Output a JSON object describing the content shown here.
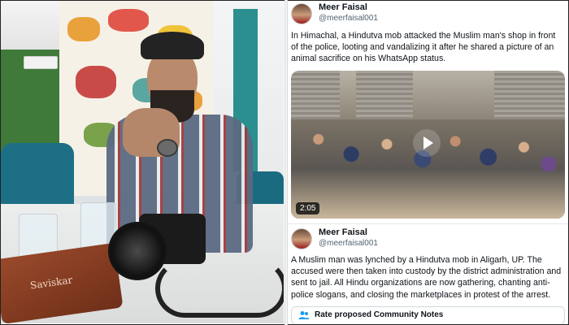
{
  "tweets": [
    {
      "name": "Meer Faisal",
      "handle": "@meerfaisal001",
      "text": "In Himachal, a Hindutva mob attacked the Muslim man's shop in front of the police, looting and vandalizing it after he shared a picture of an animal sacrifice on his WhatsApp status.",
      "video": {
        "duration": "2:05",
        "icon": "play-icon"
      }
    },
    {
      "name": "Meer Faisal",
      "handle": "@meerfaisal001",
      "text": "A Muslim man was lynched by a Hindutva mob in Aligarh, UP. The accused were then taken into custody by the district administration and sent to jail. All Hindu organizations are now gathering, chanting anti-police slogans, and closing the marketplaces in protest of the arrest."
    }
  ],
  "community_notes": {
    "label": "Rate proposed Community Notes",
    "icon": "people-icon"
  },
  "photo": {
    "case_text": "Saviskar"
  },
  "colors": {
    "text": "#0f1419",
    "muted": "#536471",
    "border": "#cfd9de"
  }
}
